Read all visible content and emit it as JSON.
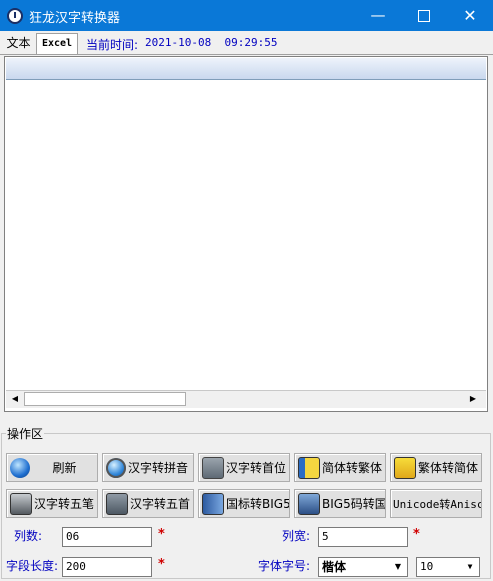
{
  "window": {
    "title": "狂龙汉字转换器",
    "min_glyph": "—",
    "close_glyph": "✕"
  },
  "tabs": [
    {
      "label": "文本"
    },
    {
      "label": "Excel"
    }
  ],
  "time": {
    "label": "当前时间:",
    "value": "2021-10-08  09:29:55"
  },
  "scrollbar": {
    "left_glyph": "◀",
    "right_glyph": "▶"
  },
  "ops": {
    "group_label": "操作区",
    "buttons_row1": [
      {
        "label": "刷新",
        "icon": "globe-icon"
      },
      {
        "label": "汉字转拼音",
        "icon": "globe-icon"
      },
      {
        "label": "汉字转首位",
        "icon": "text-icon"
      },
      {
        "label": "简体转繁体",
        "icon": "book-icon"
      },
      {
        "label": "繁体转简体",
        "icon": "book-icon"
      }
    ],
    "buttons_row2": [
      {
        "label": "汉字转五笔",
        "icon": "keyboard-icon"
      },
      {
        "label": "汉字转五首",
        "icon": "text-icon"
      },
      {
        "label": "国标转BIG5",
        "icon": "book-icon"
      },
      {
        "label": "BIG5码转国标",
        "icon": "book-icon"
      },
      {
        "label": "Unicode转Anisc",
        "icon": ""
      }
    ]
  },
  "fields": {
    "col_count_label": "列数:",
    "col_count_value": "06",
    "col_width_label": "列宽:",
    "col_width_value": "5",
    "field_length_label": "字段长度:",
    "field_length_value": "200",
    "font_size_label": "字体字号:",
    "font_value": "楷体",
    "size_value": "10",
    "required_mark": "*"
  },
  "colors": {
    "titlebar": "#0a78d7",
    "label_blue": "#0000c0",
    "required_red": "#d00000"
  }
}
